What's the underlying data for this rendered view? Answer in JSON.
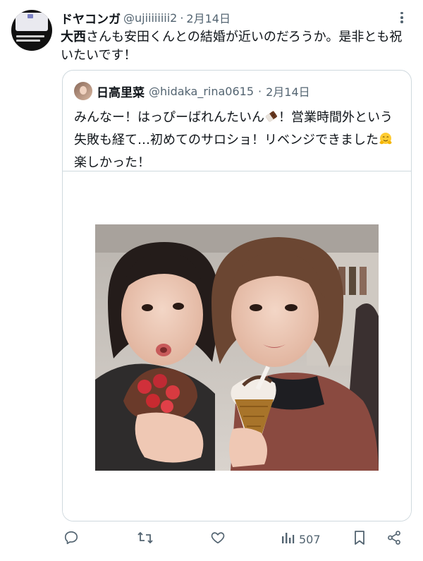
{
  "tweet": {
    "display_name": "ドヤコンガ",
    "handle": "@ujiiiiiiii2",
    "separator": "·",
    "date": "2月14日",
    "text_bold": "大西",
    "text_rest": "さんも安田くんとの結婚が近いのだろうか。是非とも祝いたいです！"
  },
  "quoted": {
    "display_name": "日高里菜",
    "handle": "@hidaka_rina0615",
    "separator": "·",
    "date": "2月14日",
    "text_part1": "みんなー！はっぴーばれんたいん",
    "text_part2": "！営業時間外という失敗も経て…初めてのサロショ！リベンジできました",
    "text_part3": "楽しかった！",
    "emoji1": "chocolate-bar",
    "emoji2": "hugging-face"
  },
  "actions": {
    "reply_icon": "reply-icon",
    "retweet_icon": "retweet-icon",
    "like_icon": "like-icon",
    "views_icon": "views-icon",
    "views_count": "507",
    "bookmark_icon": "bookmark-icon",
    "share_icon": "share-icon"
  },
  "colors": {
    "text": "#0f1419",
    "secondary": "#536471",
    "border": "#cfd9de"
  }
}
